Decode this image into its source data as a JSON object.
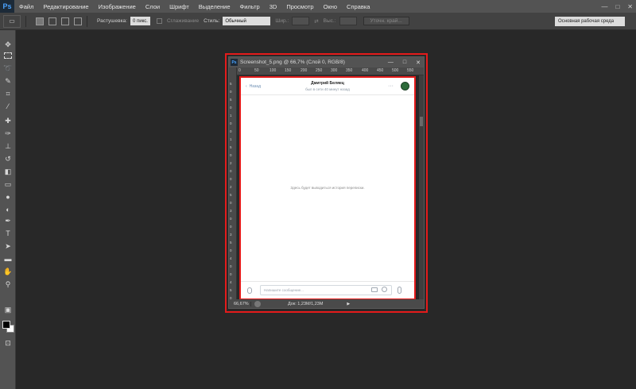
{
  "app": {
    "logo": "Ps",
    "menu": [
      "Файл",
      "Редактирование",
      "Изображение",
      "Слои",
      "Шрифт",
      "Выделение",
      "Фильтр",
      "3D",
      "Просмотр",
      "Окно",
      "Справка"
    ],
    "window_controls": [
      "—",
      "□",
      "✕"
    ]
  },
  "options": {
    "feather_label": "Растушевка:",
    "feather_value": "0 пикс.",
    "antialias_label": "Сглаживание",
    "style_label": "Стиль:",
    "style_value": "Обычный",
    "width_label": "Шир.:",
    "height_label": "Выс.:",
    "refine_button": "Уточн. край...",
    "workspace": "Основная рабочая среда"
  },
  "document": {
    "title": "Screenshot_5.png @ 66,7% (Слой 0, RGB/8)",
    "ruler_h": [
      "0",
      "50",
      "100",
      "150",
      "200",
      "250",
      "300",
      "350",
      "400",
      "450",
      "500",
      "550"
    ],
    "ruler_v": [
      "5",
      "0",
      "5",
      "0",
      "1",
      "0",
      "0",
      "1",
      "5",
      "0",
      "2",
      "0",
      "0",
      "2",
      "5",
      "0",
      "3",
      "0",
      "0",
      "3",
      "5",
      "0",
      "4",
      "0",
      "0",
      "4",
      "5",
      "0"
    ],
    "zoom": "66,67%",
    "doc_size": "Док: 1,23M/1,23M",
    "status_arrow": "▶"
  },
  "chat": {
    "back": "Назад",
    "contact_name": "Дмитрий Беляец",
    "last_seen": "был в сети 40 минут назад",
    "more": "···",
    "empty_text": "Здесь будет выводиться история переписки.",
    "input_placeholder": "Напишите сообщение..."
  },
  "colors": {
    "highlight": "#e41b1b",
    "menubar": "#535353",
    "workspace_bg": "#282828",
    "link": "#6d8fb3"
  }
}
